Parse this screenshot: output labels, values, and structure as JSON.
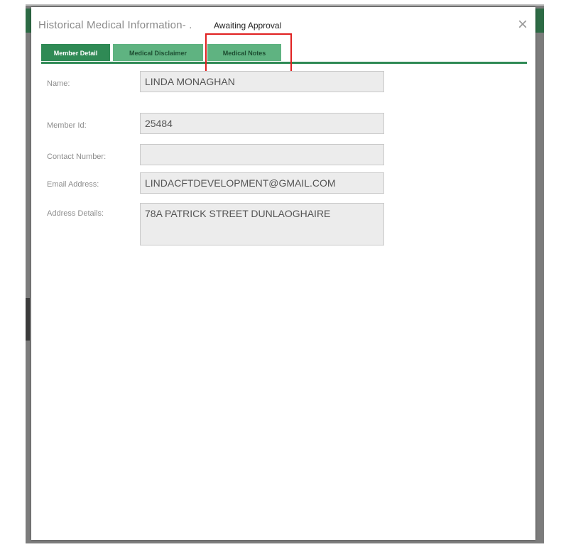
{
  "modal": {
    "title": "Historical Medical Information- .",
    "status": "Awaiting Approval",
    "close_symbol": "×"
  },
  "tabs": [
    {
      "label": "Member Detail"
    },
    {
      "label": "Medical Disclaimer"
    },
    {
      "label": "Medical Notes"
    }
  ],
  "form": {
    "name": {
      "label": "Name:",
      "value": "LINDA MONAGHAN"
    },
    "member_id": {
      "label": "Member Id:",
      "value": "25484"
    },
    "contact_number": {
      "label": "Contact Number:",
      "value": ""
    },
    "email": {
      "label": "Email Address:",
      "value": "LINDACFTDEVELOPMENT@GMAIL.COM"
    },
    "address": {
      "label": "Address Details:",
      "value": "78A PATRICK STREET DUNLAOGHAIRE"
    }
  },
  "colors": {
    "accent_green": "#2f8a55",
    "tab_inactive": "#5fb381",
    "highlight_red": "#e02020"
  }
}
